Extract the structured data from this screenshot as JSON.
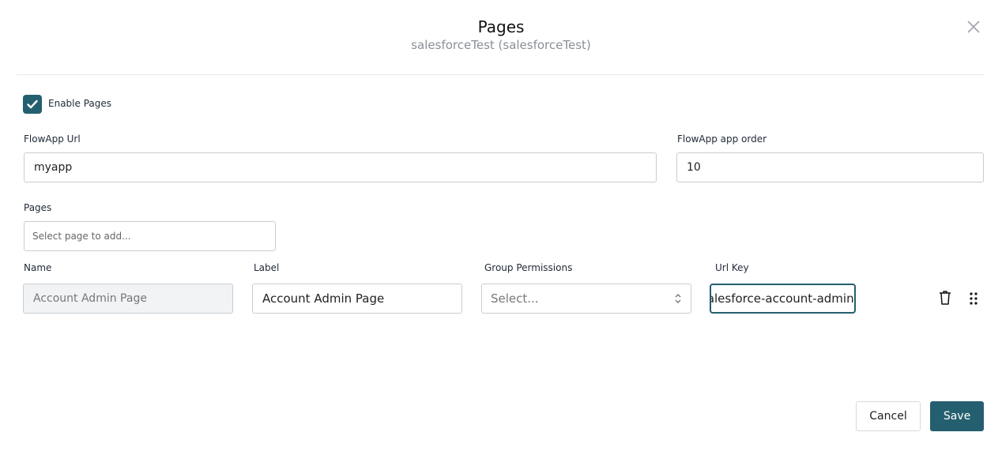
{
  "header": {
    "title": "Pages",
    "subtitle": "salesforceTest (salesforceTest)"
  },
  "enable_pages": {
    "label": "Enable Pages",
    "checked": true
  },
  "flowapp_url": {
    "label": "FlowApp Url",
    "value": "myapp"
  },
  "flowapp_order": {
    "label": "FlowApp app order",
    "value": "10"
  },
  "pages": {
    "label": "Pages",
    "placeholder": "Select page to add..."
  },
  "columns": {
    "name": "Name",
    "label": "Label",
    "group_permissions": "Group Permissions",
    "url_key": "Url Key"
  },
  "row": {
    "name": "Account Admin Page",
    "label": "Account Admin Page",
    "group_permissions_placeholder": "Select...",
    "url_key": "salesforce-account-admin"
  },
  "footer": {
    "cancel": "Cancel",
    "save": "Save"
  },
  "colors": {
    "accent": "#245f6f"
  }
}
